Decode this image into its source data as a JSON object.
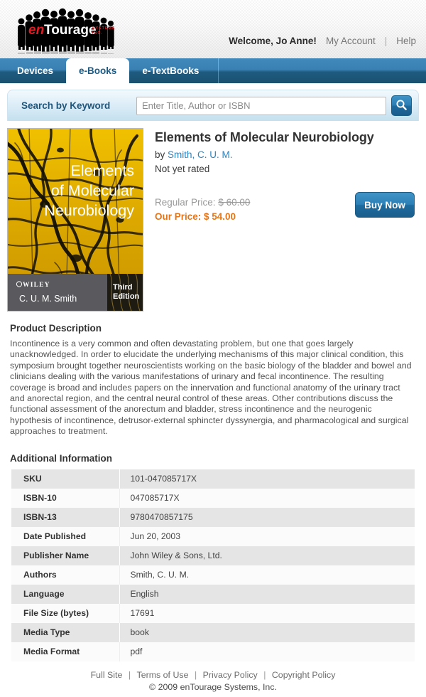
{
  "header": {
    "logo": {
      "brand_en": "en",
      "brand_tourage": "Tourage",
      "brand_systems": "SYSTEMS INC.",
      "color_red": "#e01b24",
      "color_white": "#ffffff",
      "color_silhouette": "#000000"
    },
    "welcome": "Welcome, Jo Anne!",
    "my_account": "My Account",
    "separator": "|",
    "help": "Help"
  },
  "tabs": [
    {
      "label": "Devices",
      "active": false
    },
    {
      "label": "e-Books",
      "active": true
    },
    {
      "label": "e-TextBooks",
      "active": false
    }
  ],
  "search": {
    "label": "Search by Keyword",
    "placeholder": "Enter Title, Author or ISBN",
    "value": "",
    "button_icon": "search-icon"
  },
  "product": {
    "cover": {
      "title_line1": "Elements",
      "title_line2": "of Molecular",
      "title_line3": "Neurobiology",
      "publisher": "WILEY",
      "author": "C. U. M. Smith",
      "edition_line1": "Third",
      "edition_line2": "Edition",
      "bg_color": "#e8b800",
      "texture_color": "#141008",
      "band_color": "#5a5a5e"
    },
    "title": "Elements of Molecular Neurobiology",
    "by_prefix": "by ",
    "author": "Smith, C. U. M.",
    "rating": "Not yet rated",
    "regular_price_label": "Regular Price:",
    "regular_price_amount": "$ 60.00",
    "our_price": "Our Price: $ 54.00",
    "buy_now": "Buy Now",
    "accent_price_color": "#e4751a",
    "link_color": "#2b85c4"
  },
  "description": {
    "heading": "Product Description",
    "body": "Incontinence is a very common and often devastating problem, but one that goes largely unacknowledged. In order to elucidate the underlying mechanisms of this major clinical condition, this symposium brought together neuroscientists working on the basic biology of the bladder and bowel and clinicians dealing with the various manifestations of urinary and fecal incontinence. The resulting coverage is broad and includes papers on the innervation and functional anatomy of the urinary tract and anorectal region, and the central neural control of these areas. Other contributions discuss the functional assessment of the anorectum and bladder, stress incontinence and the neurogenic hypothesis of incontinence, detrusor-external sphincter dyssynergia, and pharmacological and surgical approaches to treatment."
  },
  "additional_information": {
    "heading": "Additional Information",
    "rows": [
      {
        "label": "SKU",
        "value": "101-047085717X"
      },
      {
        "label": "ISBN-10",
        "value": "047085717X"
      },
      {
        "label": "ISBN-13",
        "value": "9780470857175"
      },
      {
        "label": "Date Published",
        "value": "Jun 20, 2003"
      },
      {
        "label": "Publisher Name",
        "value": "John Wiley & Sons, Ltd."
      },
      {
        "label": "Authors",
        "value": "Smith, C. U. M."
      },
      {
        "label": "Language",
        "value": "English"
      },
      {
        "label": "File Size (bytes)",
        "value": "17691"
      },
      {
        "label": "Media Type",
        "value": "book"
      },
      {
        "label": "Media Format",
        "value": "pdf"
      }
    ]
  },
  "footer": {
    "links": [
      "Full Site",
      "Terms of Use",
      "Privacy Policy",
      "Copyright Policy"
    ],
    "separator": "|",
    "copyright": "© 2009 enTourage Systems, Inc."
  }
}
